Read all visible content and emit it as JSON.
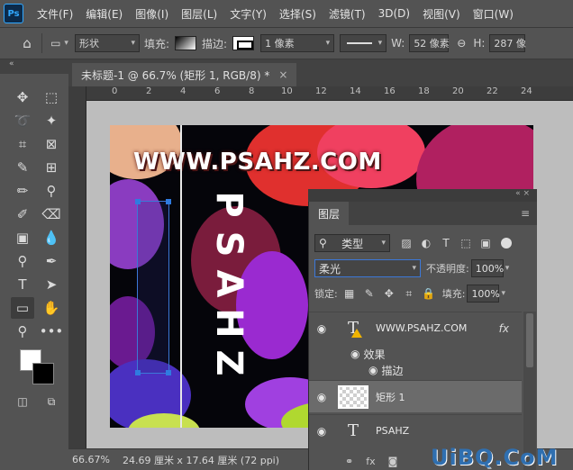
{
  "app": {
    "logo": "Ps"
  },
  "menu": [
    "文件(F)",
    "编辑(E)",
    "图像(I)",
    "图层(L)",
    "文字(Y)",
    "选择(S)",
    "滤镜(T)",
    "3D(D)",
    "视图(V)",
    "窗口(W)"
  ],
  "options": {
    "mode": "形状",
    "fill_label": "填充:",
    "stroke_label": "描边:",
    "stroke_width": "1 像素",
    "w_label": "W:",
    "w_value": "52 像素",
    "h_label": "H:",
    "h_value": "287 像"
  },
  "document": {
    "tab_title": "未标题-1 @ 66.7% (矩形 1, RGB/8) *",
    "close": "×"
  },
  "ruler": {
    "h_ticks": [
      "0",
      "2",
      "4",
      "6",
      "8",
      "10",
      "12",
      "14",
      "16",
      "18",
      "20",
      "22",
      "24"
    ]
  },
  "canvas": {
    "site_text": "WWW.PSAHZ.COM",
    "vertical_text": [
      "P",
      "S",
      "A",
      "H",
      "Z"
    ]
  },
  "status": {
    "zoom": "66.67%",
    "info": "24.69 厘米 x 17.64 厘米 (72 ppi)"
  },
  "layers_panel": {
    "tab": "图层",
    "filter_kind": "类型",
    "blend_mode": "柔光",
    "opacity_label": "不透明度:",
    "opacity_value": "100%",
    "lock_label": "锁定:",
    "fill_label": "填充:",
    "fill_value": "100%",
    "layers": [
      {
        "name": "WWW.PSAHZ.COM",
        "type": "text",
        "fx": "fx"
      },
      {
        "name": "矩形 1",
        "type": "shape"
      },
      {
        "name": "PSAHZ",
        "type": "text"
      }
    ],
    "effects_label": "效果",
    "stroke_effect_label": "描边",
    "bottom_fx": "fx"
  },
  "watermark": "UiBQ.CoM",
  "colors": {
    "selection": "#2f7be0",
    "warning": "#f0b400",
    "watermark": "#2f6fb0"
  }
}
